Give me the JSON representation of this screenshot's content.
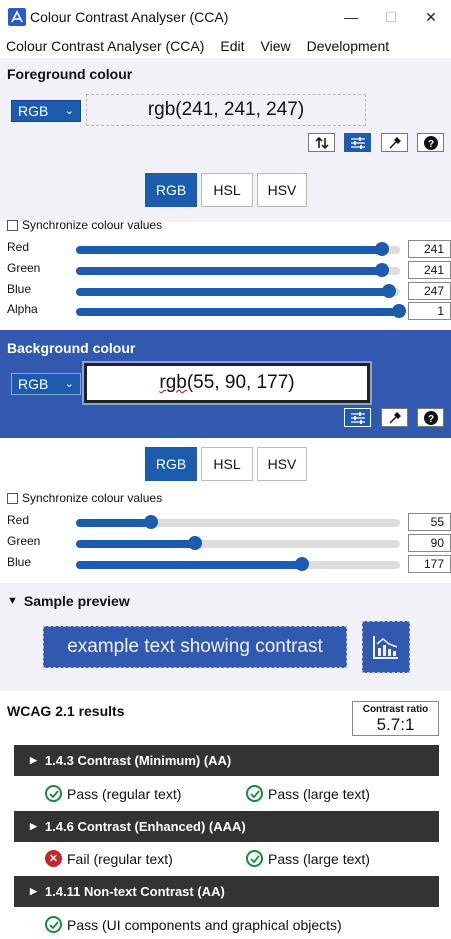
{
  "window": {
    "title": "Colour Contrast Analyser (CCA)",
    "minimize": "—",
    "maximize": "☐",
    "close": "✕"
  },
  "menu": [
    "Colour Contrast Analyser (CCA)",
    "Edit",
    "View",
    "Development"
  ],
  "foreground": {
    "heading": "Foreground colour",
    "format": "RGB",
    "value": "rgb(241, 241, 247)",
    "tabs": [
      "RGB",
      "HSL",
      "HSV"
    ],
    "selected_tab": "RGB",
    "sync_label": "Synchronize colour values",
    "sliders": [
      {
        "label": "Red",
        "value": "241",
        "fraction": 0.945
      },
      {
        "label": "Green",
        "value": "241",
        "fraction": 0.945
      },
      {
        "label": "Blue",
        "value": "247",
        "fraction": 0.969
      },
      {
        "label": "Alpha",
        "value": "1",
        "fraction": 1.0
      }
    ]
  },
  "background": {
    "heading": "Background colour",
    "format": "RGB",
    "value_prefix": "rgb",
    "value_rest": "(55, 90, 177)",
    "tabs": [
      "RGB",
      "HSL",
      "HSV"
    ],
    "selected_tab": "RGB",
    "sync_label": "Synchronize colour values",
    "sliders": [
      {
        "label": "Red",
        "value": "55",
        "fraction": 0.216
      },
      {
        "label": "Green",
        "value": "90",
        "fraction": 0.353
      },
      {
        "label": "Blue",
        "value": "177",
        "fraction": 0.694
      }
    ]
  },
  "preview": {
    "heading": "Sample preview",
    "sample_text": "example text showing contrast"
  },
  "results": {
    "heading": "WCAG 2.1 results",
    "ratio_label": "Contrast ratio",
    "ratio_value": "5.7:1",
    "criteria": [
      {
        "title": "1.4.3 Contrast (Minimum) (AA)",
        "items": [
          {
            "status": "pass",
            "text": "Pass (regular text)"
          },
          {
            "status": "pass",
            "text": "Pass (large text)"
          }
        ]
      },
      {
        "title": "1.4.6 Contrast (Enhanced) (AAA)",
        "items": [
          {
            "status": "fail",
            "text": "Fail (regular text)"
          },
          {
            "status": "pass",
            "text": "Pass (large text)"
          }
        ]
      },
      {
        "title": "1.4.11 Non-text Contrast (AA)",
        "items": [
          {
            "status": "pass",
            "text": "Pass (UI components and graphical objects)"
          }
        ]
      }
    ]
  },
  "colors": {
    "accent": "#1b5cae",
    "background_panel": "#3159b0",
    "pass": "#1a8a3a",
    "fail": "#c8242b"
  }
}
